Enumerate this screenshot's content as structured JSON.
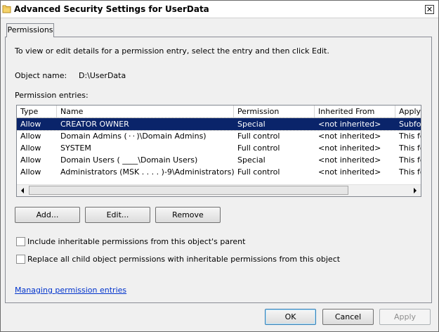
{
  "window": {
    "title": "Advanced Security Settings for UserData",
    "close_glyph": "✕"
  },
  "tabs": [
    {
      "label": "Permissions"
    }
  ],
  "permissions": {
    "instructions": "To view or edit details for a permission entry, select the entry and then click Edit.",
    "object_name_label": "Object name:",
    "object_name_value": "D:\\UserData",
    "entries_label": "Permission entries:",
    "columns": [
      "Type",
      "Name",
      "Permission",
      "Inherited From",
      "Apply"
    ],
    "rows": [
      {
        "type": "Allow",
        "name": "CREATOR OWNER",
        "permission": "Special",
        "inherited": "<not inherited>",
        "apply": "Subfol"
      },
      {
        "type": "Allow",
        "name": "Domain Admins ( · · )\\Domain Admins)",
        "permission": "Full control",
        "inherited": "<not inherited>",
        "apply": "This fo"
      },
      {
        "type": "Allow",
        "name": "SYSTEM",
        "permission": "Full control",
        "inherited": "<not inherited>",
        "apply": "This fo"
      },
      {
        "type": "Allow",
        "name": "Domain Users ( ____\\Domain Users)",
        "permission": "Special",
        "inherited": "<not inherited>",
        "apply": "This fo"
      },
      {
        "type": "Allow",
        "name": "Administrators (MSK . . . .          )-9\\Administrators)",
        "permission": "Full control",
        "inherited": "<not inherited>",
        "apply": "This fo"
      }
    ],
    "selected_row": 0,
    "buttons": {
      "add": "Add...",
      "edit": "Edit...",
      "remove": "Remove"
    },
    "checkbox_inherit": "Include inheritable permissions from this object's parent",
    "checkbox_replace": "Replace all child object permissions with inheritable permissions from this object",
    "checkbox_inherit_checked": false,
    "checkbox_replace_checked": false,
    "help_link": "Managing permission entries"
  },
  "footer": {
    "ok": "OK",
    "cancel": "Cancel",
    "apply": "Apply"
  },
  "icons": {
    "title": "folder-icon",
    "scroll_left": "arrow-left-icon",
    "scroll_right": "arrow-right-icon"
  },
  "colors": {
    "selection": "#0a246a",
    "link": "#0033cc"
  }
}
